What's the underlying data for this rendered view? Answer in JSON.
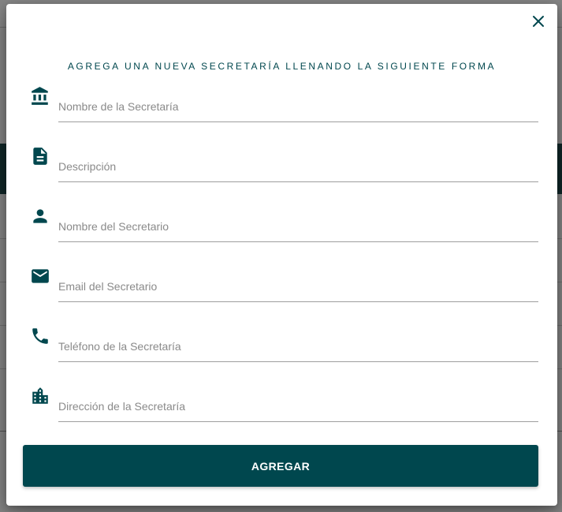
{
  "theme": {
    "accent": "#00474e",
    "underline": "#9e9e9e"
  },
  "modal": {
    "close_icon": "close-icon",
    "title": "AGREGA UNA NUEVA SECRETARÍA LLENANDO LA SIGUIENTE FORMA",
    "fields": [
      {
        "icon": "bank-icon",
        "placeholder": "Nombre de la Secretaría",
        "value": ""
      },
      {
        "icon": "document-icon",
        "placeholder": "Descripción",
        "value": ""
      },
      {
        "icon": "person-icon",
        "placeholder": "Nombre del Secretario",
        "value": ""
      },
      {
        "icon": "email-icon",
        "placeholder": "Email del Secretario",
        "value": ""
      },
      {
        "icon": "phone-icon",
        "placeholder": "Teléfono de la Secretaría",
        "value": ""
      },
      {
        "icon": "building-icon",
        "placeholder": "Dirección de la Secretaría",
        "value": ""
      }
    ],
    "submit_label": "AGREGAR"
  }
}
